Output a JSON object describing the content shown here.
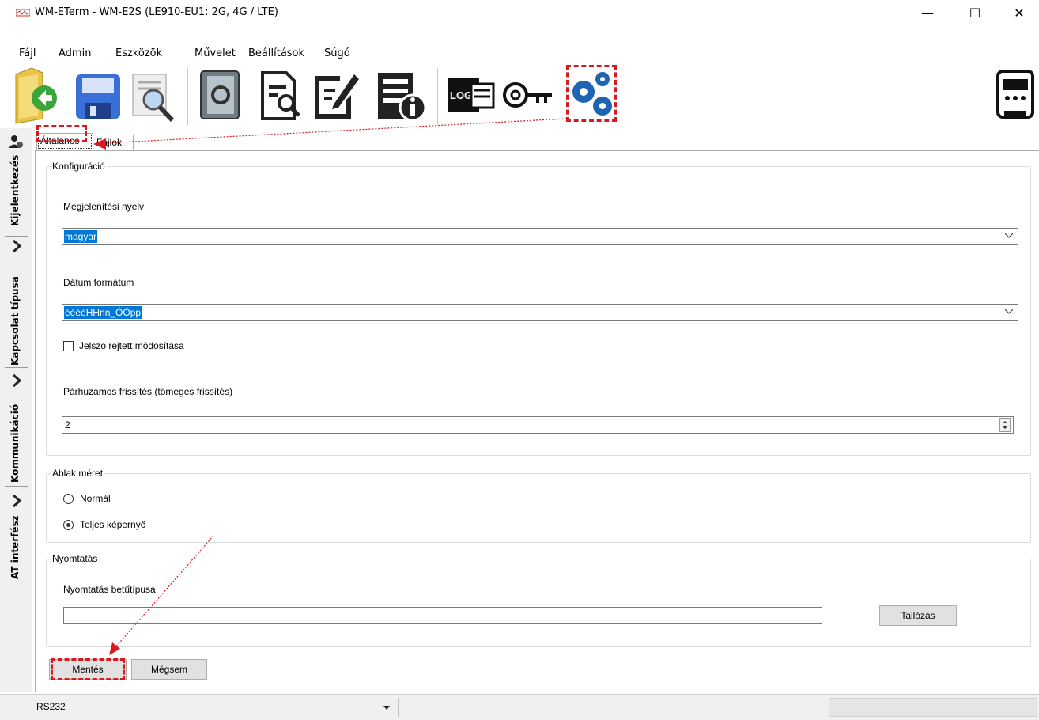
{
  "window": {
    "title": "WM-ETerm - WM-E2S (LE910-EU1: 2G, 4G / LTE)",
    "minimize": "—",
    "maximize": "☐",
    "close": "✕"
  },
  "menu": {
    "items": [
      "Fájl",
      "Admin",
      "Eszközök",
      "Művelet",
      "Beállítások",
      "Súgó"
    ]
  },
  "toolbar": {
    "icons": [
      "open-folder-icon",
      "save-disk-icon",
      "search-document-icon",
      "notebook-icon",
      "document-search-icon",
      "edit-document-icon",
      "document-info-icon",
      "log-file-icon",
      "key-refresh-icon",
      "settings-gears-icon",
      "meter-icon"
    ],
    "log_label": "LOG"
  },
  "leftnav": {
    "items": [
      "Kijelentkezés",
      "Kapcsolat típusa",
      "Kommunikáció",
      "AT interfész"
    ]
  },
  "tabs": [
    "Általános",
    "Fájlok"
  ],
  "config": {
    "legend": "Konfiguráció",
    "language_label": "Megjelenítési nyelv",
    "language_value": "magyar",
    "date_format_label": "Dátum formátum",
    "date_format_value": "ééééHHnn_ÓÓpp",
    "password_checkbox_label": "Jelszó rejtett módosítása",
    "password_checked": false,
    "parallel_label": "Párhuzamos frissítés (tömeges frissítés)",
    "parallel_value": "2"
  },
  "window_size": {
    "legend": "Ablak méret",
    "normal_label": "Normál",
    "fullscreen_label": "Teljes képernyő",
    "selected": "Teljes képernyő"
  },
  "printing": {
    "legend": "Nyomtatás",
    "font_label": "Nyomtatás betűtípusa",
    "font_value": "",
    "browse_button": "Tallózás"
  },
  "actions": {
    "save": "Mentés",
    "cancel": "Mégsem"
  },
  "statusbar": {
    "port": "RS232"
  },
  "colors": {
    "highlight_blue": "#0078d7",
    "annotation_red": "#d71920"
  }
}
